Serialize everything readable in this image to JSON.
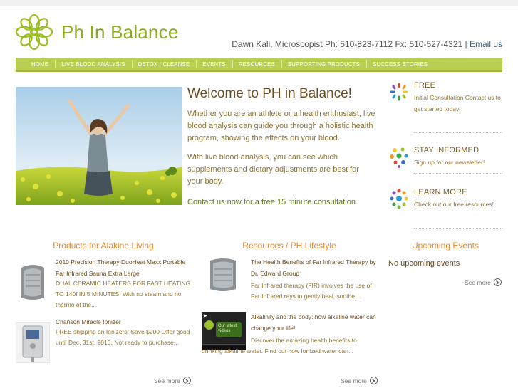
{
  "brand": {
    "name": "Ph In Balance",
    "accent": "#b9cf51",
    "logo_icon": "flower-logo-icon"
  },
  "contact": {
    "line": "Dawn Kali, Microscopist Ph: 510-823-7112 Fx: 510-527-4321 |",
    "email_label": "Email us"
  },
  "nav": {
    "items": [
      "Home",
      "Live Blood Analysis",
      "Detox / Cleanse",
      "Events",
      "Resources",
      "Supporting Products",
      "Success Stories"
    ]
  },
  "hero": {
    "image": "woman-in-flower-field-photo"
  },
  "welcome": {
    "title": "Welcome to PH in Balance!",
    "p1": "Whether you are an athlete or a health enthusiast, live blood analysis can guide you through a holistic health program, showing the effects on your blood.",
    "p2": "With live blood analysis, you can see which supplements and dietary adjustments are best for your body.",
    "cta": "Contact us now for a free 15 minute consultation"
  },
  "sidebar": [
    {
      "title": "Free",
      "text": "Initial Consultation Contact us to get started today!",
      "icon": "consultation-ring-icon"
    },
    {
      "title": "Stay Informed",
      "text": "Sign up for our newsletter!",
      "icon": "newsletter-burst-icon"
    },
    {
      "title": "Learn More",
      "text": "Check out our free resources!",
      "icon": "resources-dots-icon"
    }
  ],
  "products": {
    "heading": "Products for Alakine Living",
    "items": [
      {
        "title": "2010 Precision Therapy DuoHeat Maxx Portable Far Infrared Sauna Extra Large",
        "desc": "DUAL CERAMIC HEATERS FOR FAST HEATING TO 140f IN 5 MINUTES! With no steam and no thermo of the..."
      },
      {
        "title": "Chanson Miracle Ionizer",
        "desc": "FREE shipping on Ionizers! Save $200 Offer good until Dec. 31st, 2010. Not ready to purchase..."
      }
    ],
    "see_more": "See more"
  },
  "resources": {
    "heading": "Resources / PH Lifestyle",
    "items": [
      {
        "title": "The Health Benefits of Far Infrared Therapy by Dr. Edward Group",
        "desc": "Far Infrared therapy (FIR) involves the use of Far Infrared rays to gently heal, soothe,..."
      },
      {
        "title": "Alkalinity and the body: how alkaline water can change your life!",
        "desc": "Discover the amazing health benefits to drinking alkaline water. Find out how Ionized water can...",
        "thumb_caption": "Our latest videos"
      }
    ],
    "see_more": "See more"
  },
  "events": {
    "heading": "Upcoming Events",
    "empty": "No upcoming events",
    "see_more": "See more"
  }
}
